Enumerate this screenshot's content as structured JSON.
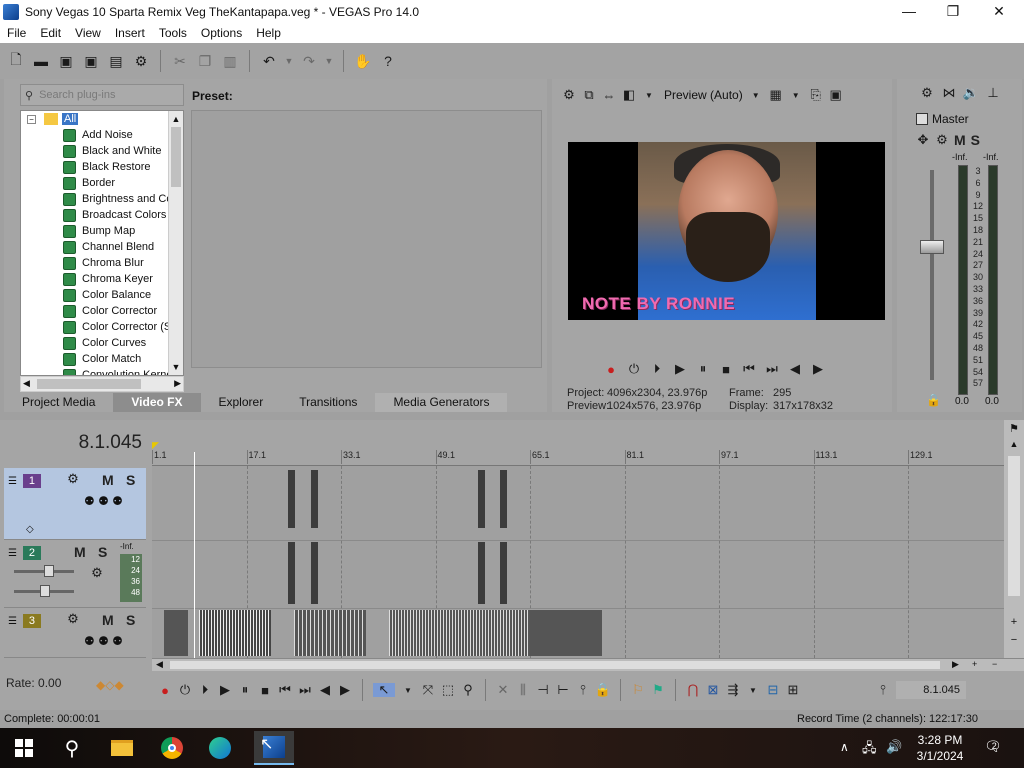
{
  "window": {
    "title": "Sony Vegas 10 Sparta Remix Veg TheKantapapa.veg * - VEGAS Pro 14.0",
    "minimize": "—",
    "maximize": "❐",
    "close": "✕"
  },
  "menu": [
    "File",
    "Edit",
    "View",
    "Insert",
    "Tools",
    "Options",
    "Help"
  ],
  "plugins": {
    "search_placeholder": "Search plug-ins",
    "root": "All",
    "items": [
      "Add Noise",
      "Black and White",
      "Black Restore",
      "Border",
      "Brightness and Co",
      "Broadcast Colors",
      "Bump Map",
      "Channel Blend",
      "Chroma Blur",
      "Chroma Keyer",
      "Color Balance",
      "Color Corrector",
      "Color Corrector (S",
      "Color Curves",
      "Color Match",
      "Convolution Kerne"
    ],
    "preset_label": "Preset:"
  },
  "tabs": [
    {
      "label": "Project Media",
      "active": false
    },
    {
      "label": "Video FX",
      "active": true
    },
    {
      "label": "Explorer",
      "active": false
    },
    {
      "label": "Transitions",
      "active": false
    },
    {
      "label": "Media Generators",
      "active": false
    }
  ],
  "preview": {
    "mode": "Preview (Auto)",
    "overlay_text": "NOTE BY RONNIE",
    "project_label": "Project:",
    "project_value": "4096x2304, 23.976p",
    "preview_label": "Preview:",
    "preview_value": "1024x576, 23.976p",
    "frame_label": "Frame:",
    "frame_value": "295",
    "display_label": "Display:",
    "display_value": "317x178x32"
  },
  "mixer": {
    "master_label": "Master",
    "inf_left": "-Inf.",
    "inf_right": "-Inf.",
    "scale": [
      "3",
      "6",
      "9",
      "12",
      "15",
      "18",
      "21",
      "24",
      "27",
      "30",
      "33",
      "36",
      "39",
      "42",
      "45",
      "48",
      "51",
      "54",
      "57"
    ],
    "level_left": "0.0",
    "level_right": "0.0"
  },
  "timeline": {
    "timecode": "8.1.045",
    "ruler": [
      "1.1",
      "17.1",
      "33.1",
      "49.1",
      "65.1",
      "81.1",
      "97.1",
      "113.1",
      "129.1"
    ],
    "tracks": [
      {
        "num": "1",
        "type": "video",
        "m": "M",
        "s": "S"
      },
      {
        "num": "2",
        "type": "audio",
        "m": "M",
        "s": "S",
        "inf": "-Inf.",
        "levels": [
          "12",
          "24",
          "36",
          "48"
        ]
      },
      {
        "num": "3",
        "type": "video",
        "m": "M",
        "s": "S"
      }
    ],
    "rate": "Rate: 0.00",
    "position": "8.1.045"
  },
  "status": {
    "left": "Complete: 00:00:01",
    "right": "Record Time (2 channels): 122:17:30"
  },
  "taskbar": {
    "time": "3:28 PM",
    "date": "3/1/2024",
    "notification_count": "2"
  }
}
